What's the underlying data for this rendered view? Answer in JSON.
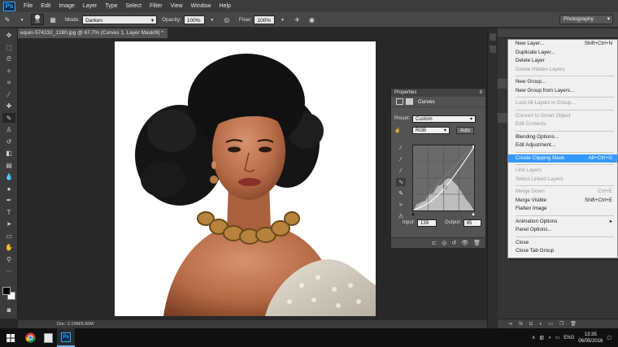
{
  "menubar": {
    "logo": "Ps",
    "items": [
      "File",
      "Edit",
      "Image",
      "Layer",
      "Type",
      "Select",
      "Filter",
      "View",
      "Window",
      "Help"
    ]
  },
  "options": {
    "brush_size": "35",
    "mode_label": "Mode:",
    "mode_value": "Darken",
    "opacity_label": "Opacity:",
    "opacity_value": "100%",
    "flow_label": "Flow:",
    "flow_value": "100%",
    "workspace": "Photography"
  },
  "document": {
    "tab_title": "equin-574232_1280.jpg @ 67.7% (Curves 1, Layer Mask/8) *",
    "status": "Doc: 2.19M/5.06M"
  },
  "properties": {
    "panel_title": "Properties",
    "adjustment": "Curves",
    "preset_label": "Preset:",
    "preset_value": "Custom",
    "channel": "RGB",
    "auto_label": "Auto",
    "input_label": "Input:",
    "input_value": "139",
    "output_label": "Output:",
    "output_value": "85"
  },
  "context_menu": {
    "items": [
      {
        "label": "New Layer...",
        "shortcut": "Shift+Ctrl+N",
        "disabled": false
      },
      {
        "label": "Duplicate Layer...",
        "shortcut": "",
        "disabled": false
      },
      {
        "label": "Delete Layer",
        "shortcut": "",
        "disabled": false
      },
      {
        "label": "Delete Hidden Layers",
        "shortcut": "",
        "disabled": true
      },
      {
        "sep": true
      },
      {
        "label": "New Group...",
        "shortcut": "",
        "disabled": false
      },
      {
        "label": "New Group from Layers...",
        "shortcut": "",
        "disabled": false
      },
      {
        "sep": true
      },
      {
        "label": "Lock All Layers in Group...",
        "shortcut": "",
        "disabled": true
      },
      {
        "sep": true
      },
      {
        "label": "Convert to Smart Object",
        "shortcut": "",
        "disabled": true
      },
      {
        "label": "Edit Contents",
        "shortcut": "",
        "disabled": true
      },
      {
        "sep": true
      },
      {
        "label": "Blending Options...",
        "shortcut": "",
        "disabled": false
      },
      {
        "label": "Edit Adjustment...",
        "shortcut": "",
        "disabled": false
      },
      {
        "sep": true
      },
      {
        "label": "Create Clipping Mask",
        "shortcut": "Alt+Ctrl+G",
        "disabled": false,
        "highlight": true
      },
      {
        "sep": true
      },
      {
        "label": "Link Layers",
        "shortcut": "",
        "disabled": true
      },
      {
        "label": "Select Linked Layers",
        "shortcut": "",
        "disabled": true
      },
      {
        "sep": true
      },
      {
        "label": "Merge Down",
        "shortcut": "Ctrl+E",
        "disabled": true
      },
      {
        "label": "Merge Visible",
        "shortcut": "Shift+Ctrl+E",
        "disabled": false
      },
      {
        "label": "Flatten Image",
        "shortcut": "",
        "disabled": false
      },
      {
        "sep": true
      },
      {
        "label": "Animation Options",
        "shortcut": "▸",
        "disabled": false
      },
      {
        "label": "Panel Options...",
        "shortcut": "",
        "disabled": false
      },
      {
        "sep": true
      },
      {
        "label": "Close",
        "shortcut": "",
        "disabled": false
      },
      {
        "label": "Close Tab Group",
        "shortcut": "",
        "disabled": false
      }
    ]
  },
  "taskbar": {
    "language": "ENG",
    "time": "13:35",
    "date": "06/05/2016"
  },
  "colors": {
    "accent": "#3399ff",
    "ps_blue": "#31a8ff"
  }
}
